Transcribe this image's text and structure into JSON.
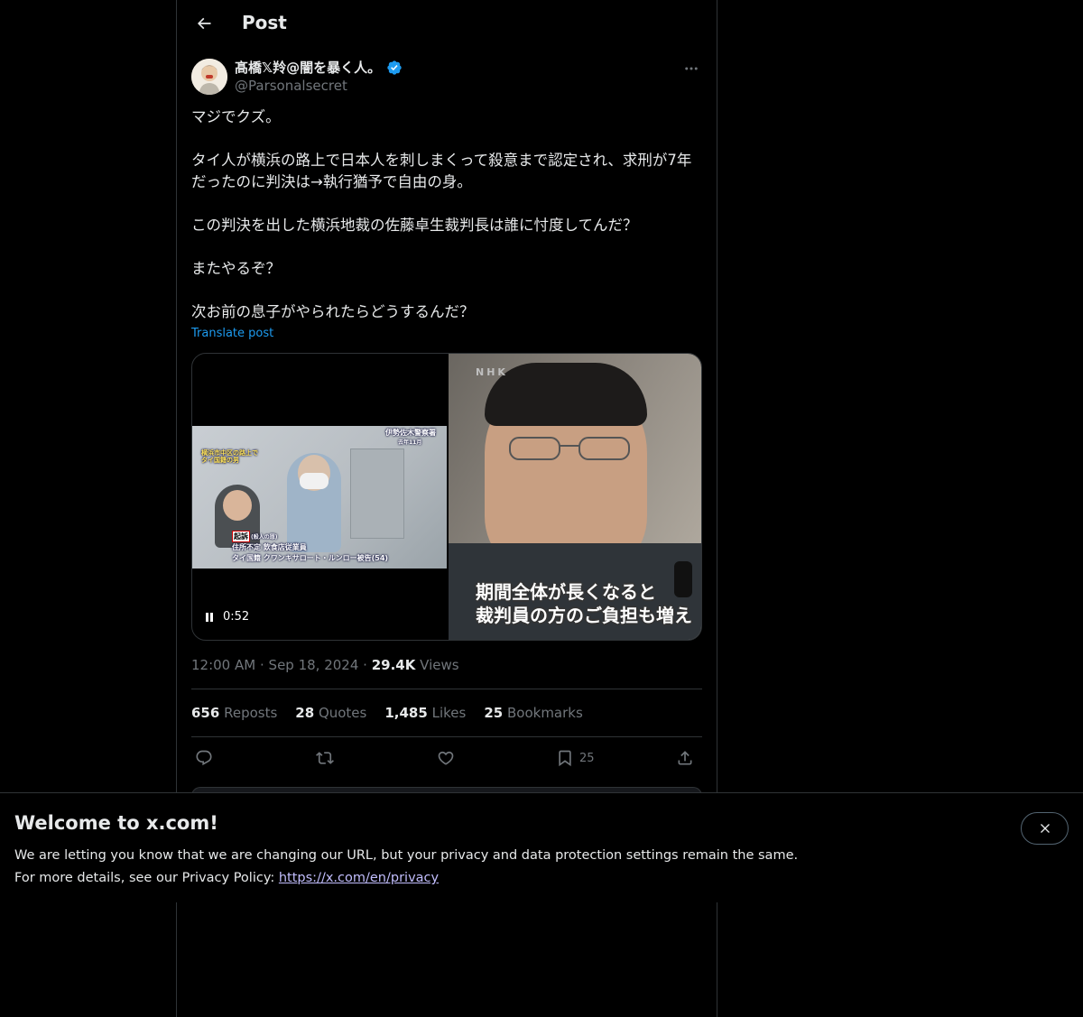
{
  "header": {
    "title": "Post"
  },
  "post": {
    "author": {
      "display_name": "髙橋𝕏羚@闇を暴く人。",
      "handle": "@Parsonalsecret",
      "verified": true
    },
    "text": "マジでクズ。\n\nタイ人が横浜の路上で日本人を刺しまくって殺意まで認定され、求刑が7年だったのに判決は→執行猶予で自由の身。\n\nこの判決を出した横浜地裁の佐藤卓生裁判長は誰に忖度してんだ？\n\nまたやるぞ？\n\n次お前の息子がやられたらどうするんだ？",
    "translate_label": "Translate post",
    "video": {
      "duration": "0:52",
      "left_frame": {
        "top_caption": "伊勢佐木警察署",
        "top_caption_sub": "去年11月",
        "side_caption_1": "横浜市中区の路上で",
        "side_caption_2": "タイ国籍の男",
        "charge_label": "起訴",
        "charge_detail": "(殺人の罪)",
        "line_1": "住所不定 飲食店従業員",
        "line_2": "タイ国籍 クワンキサロート・ルンロー被告(54)"
      },
      "right_frame": {
        "logo": "NHK",
        "subtitle_1": "期間全体が長くなると",
        "subtitle_2": "裁判員の方のご負担も増え"
      }
    },
    "time": "12:00 AM",
    "date": "Sep 18, 2024",
    "views_count": "29.4K",
    "views_label": "Views",
    "separator": "·",
    "stats": {
      "reposts_count": "656",
      "reposts_label": "Reposts",
      "quotes_count": "28",
      "quotes_label": "Quotes",
      "likes_count": "1,485",
      "likes_label": "Likes",
      "bookmarks_count": "25",
      "bookmarks_label": "Bookmarks"
    },
    "actions": {
      "bookmark_count": "25"
    }
  },
  "banner": {
    "title": "Welcome to x.com!",
    "line_1": "We are letting you know that we are changing our URL, but your privacy and data protection settings remain the same.",
    "line_2_prefix": "For more details, see our Privacy Policy:",
    "link_text": "https://x.com/en/privacy"
  },
  "colors": {
    "background": "#000000",
    "text_primary": "#e7e9ea",
    "text_secondary": "#71767b",
    "link": "#1d9bf0",
    "border": "#2f3336",
    "verified_badge": "#1d9bf0"
  }
}
